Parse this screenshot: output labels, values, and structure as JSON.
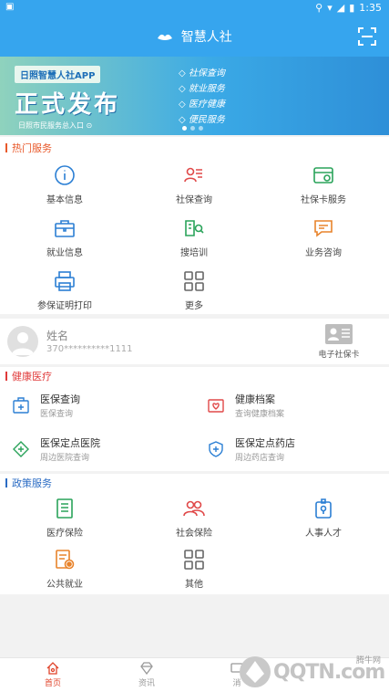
{
  "status": {
    "time": "1:35",
    "left_icon": "notification-icon"
  },
  "appbar": {
    "title": "智慧人社",
    "scan_icon": "scan-icon"
  },
  "banner": {
    "tag": "日照智慧人社APP",
    "headline": "正式发布",
    "entry": "日照市民服务总入口",
    "features": [
      "社保查询",
      "就业服务",
      "医疗健康",
      "便民服务"
    ]
  },
  "hot": {
    "title": "热门服务",
    "items": [
      {
        "label": "基本信息",
        "icon": "info-icon"
      },
      {
        "label": "社保查询",
        "icon": "id-card-icon"
      },
      {
        "label": "社保卡服务",
        "icon": "card-icon"
      },
      {
        "label": "就业信息",
        "icon": "briefcase-icon"
      },
      {
        "label": "搜培训",
        "icon": "search-book-icon"
      },
      {
        "label": "业务咨询",
        "icon": "chat-icon"
      },
      {
        "label": "参保证明打印",
        "icon": "printer-icon"
      },
      {
        "label": "更多",
        "icon": "grid-icon"
      }
    ]
  },
  "profile": {
    "name": "姓名",
    "id": "370**********1111",
    "card_label": "电子社保卡"
  },
  "health": {
    "title": "健康医疗",
    "items": [
      {
        "title": "医保查询",
        "sub": "医保查询",
        "icon": "medkit-icon"
      },
      {
        "title": "健康档案",
        "sub": "查询健康档案",
        "icon": "health-file-icon"
      },
      {
        "title": "医保定点医院",
        "sub": "周边医院查询",
        "icon": "hospital-icon"
      },
      {
        "title": "医保定点药店",
        "sub": "周边药店查询",
        "icon": "pharmacy-icon"
      }
    ]
  },
  "policy": {
    "title": "政策服务",
    "items": [
      {
        "label": "医疗保险",
        "icon": "document-icon"
      },
      {
        "label": "社会保险",
        "icon": "people-icon"
      },
      {
        "label": "人事人才",
        "icon": "badge-icon"
      },
      {
        "label": "公共就业",
        "icon": "employment-icon"
      },
      {
        "label": "其他",
        "icon": "grid-icon"
      }
    ]
  },
  "nav": {
    "items": [
      {
        "label": "首页",
        "icon": "home-icon"
      },
      {
        "label": "资讯",
        "icon": "news-icon"
      },
      {
        "label": "消",
        "icon": "message-icon"
      }
    ]
  },
  "watermark": {
    "text": "QQTN.com",
    "sub": "腾牛网"
  },
  "colors": {
    "primary": "#36a5ee",
    "hot": "#e8592b",
    "health": "#e03a3a",
    "policy": "#2b6cc4",
    "nav_active": "#e0442b"
  }
}
